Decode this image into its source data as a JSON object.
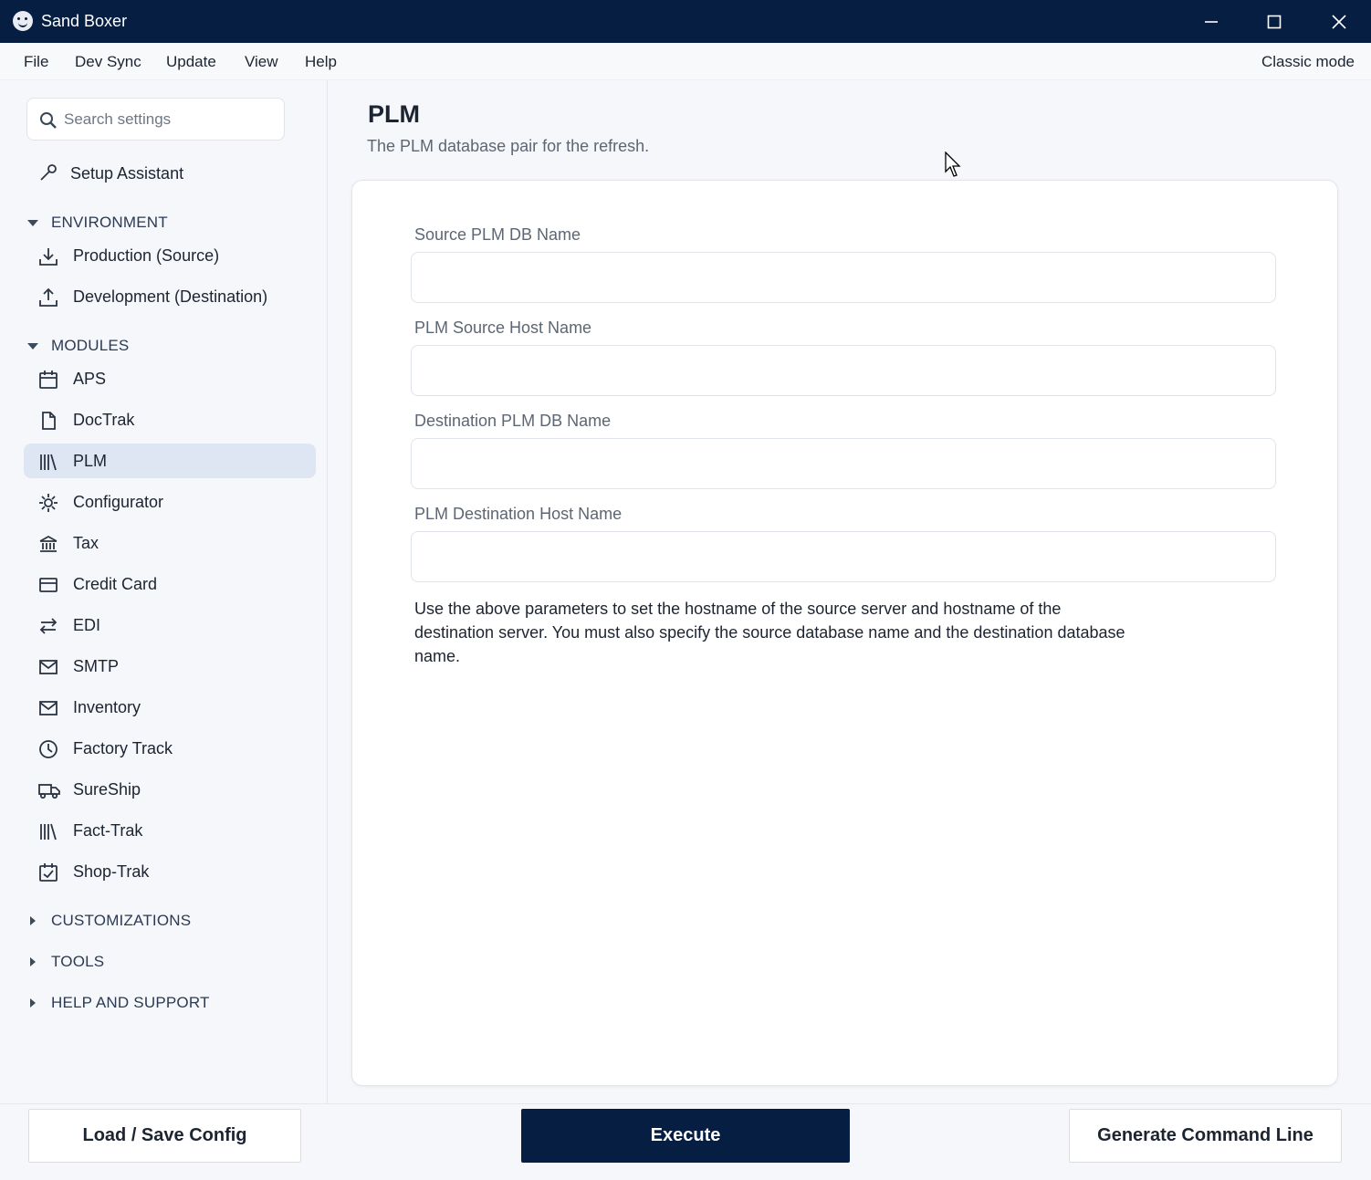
{
  "window": {
    "title": "Sand Boxer",
    "app_icon": "smiley-icon",
    "controls": [
      "minimize-icon",
      "maximize-icon",
      "close-icon"
    ]
  },
  "menu": {
    "items": [
      "File",
      "Dev Sync",
      "Update",
      "View",
      "Help"
    ],
    "classic_mode": "Classic mode"
  },
  "sidebar": {
    "search_placeholder": "Search settings",
    "setup": {
      "label": "Setup Assistant",
      "icon": "wrench-icon"
    },
    "sections": {
      "environment": "ENVIRONMENT",
      "modules": "MODULES",
      "customizations": "CUSTOMIZATIONS",
      "tools": "TOOLS",
      "help": "HELP AND SUPPORT"
    },
    "environment_items": [
      {
        "label": "Production (Source)",
        "icon": "download-icon"
      },
      {
        "label": "Development (Destination)",
        "icon": "upload-icon"
      }
    ],
    "module_items": [
      {
        "label": "APS",
        "icon": "calendar-icon"
      },
      {
        "label": "DocTrak",
        "icon": "document-icon"
      },
      {
        "label": "PLM",
        "icon": "library-icon",
        "active": true
      },
      {
        "label": "Configurator",
        "icon": "gear-icon"
      },
      {
        "label": "Tax",
        "icon": "bank-icon"
      },
      {
        "label": "Credit Card",
        "icon": "credit-card-icon"
      },
      {
        "label": "EDI",
        "icon": "swap-icon"
      },
      {
        "label": "SMTP",
        "icon": "mail-icon"
      },
      {
        "label": "Inventory",
        "icon": "mail-icon"
      },
      {
        "label": "Factory Track",
        "icon": "clock-icon"
      },
      {
        "label": "SureShip",
        "icon": "truck-icon"
      },
      {
        "label": "Fact-Trak",
        "icon": "library-icon"
      },
      {
        "label": "Shop-Trak",
        "icon": "calendar-check-icon"
      }
    ],
    "accent_color": "#dfe6f3"
  },
  "main": {
    "title": "PLM",
    "subtitle": "The PLM database pair for the refresh.",
    "fields": [
      {
        "label": "Source PLM DB Name",
        "value": ""
      },
      {
        "label": "PLM Source Host Name",
        "value": ""
      },
      {
        "label": "Destination PLM DB Name",
        "value": ""
      },
      {
        "label": "PLM Destination Host Name",
        "value": ""
      }
    ],
    "help_text": "Use the above parameters to set the hostname of the source server and hostname of the destination server. You must also specify the source database name and the destination database name."
  },
  "footer": {
    "load_save": "Load / Save Config",
    "execute": "Execute",
    "generate": "Generate Command Line",
    "primary_color": "#051e41"
  }
}
